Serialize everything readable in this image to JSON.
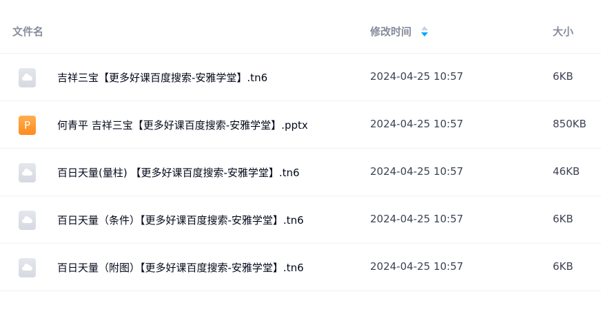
{
  "header": {
    "name_label": "文件名",
    "time_label": "修改时间",
    "size_label": "大小",
    "sort_icon": "sort-descending-icon"
  },
  "colors": {
    "sort_active": "#06a7ff",
    "ppt_icon": "#ff8a1f",
    "generic_icon": "#d5d9e1"
  },
  "files": [
    {
      "icon": "cloud-file-icon",
      "name": "吉祥三宝【更多好课百度搜索-安雅学堂】.tn6",
      "modified": "2024-04-25 10:57",
      "size": "6KB"
    },
    {
      "icon": "ppt-file-icon",
      "icon_glyph": "P",
      "name": "何青平 吉祥三宝【更多好课百度搜索-安雅学堂】.pptx",
      "modified": "2024-04-25 10:57",
      "size": "850KB"
    },
    {
      "icon": "cloud-file-icon",
      "name": "百日天量(量柱) 【更多好课百度搜索-安雅学堂】.tn6",
      "modified": "2024-04-25 10:57",
      "size": "46KB"
    },
    {
      "icon": "cloud-file-icon",
      "name": "百日天量（条件）【更多好课百度搜索-安雅学堂】.tn6",
      "modified": "2024-04-25 10:57",
      "size": "6KB"
    },
    {
      "icon": "cloud-file-icon",
      "name": "百日天量（附图）【更多好课百度搜索-安雅学堂】.tn6",
      "modified": "2024-04-25 10:57",
      "size": "6KB"
    }
  ]
}
